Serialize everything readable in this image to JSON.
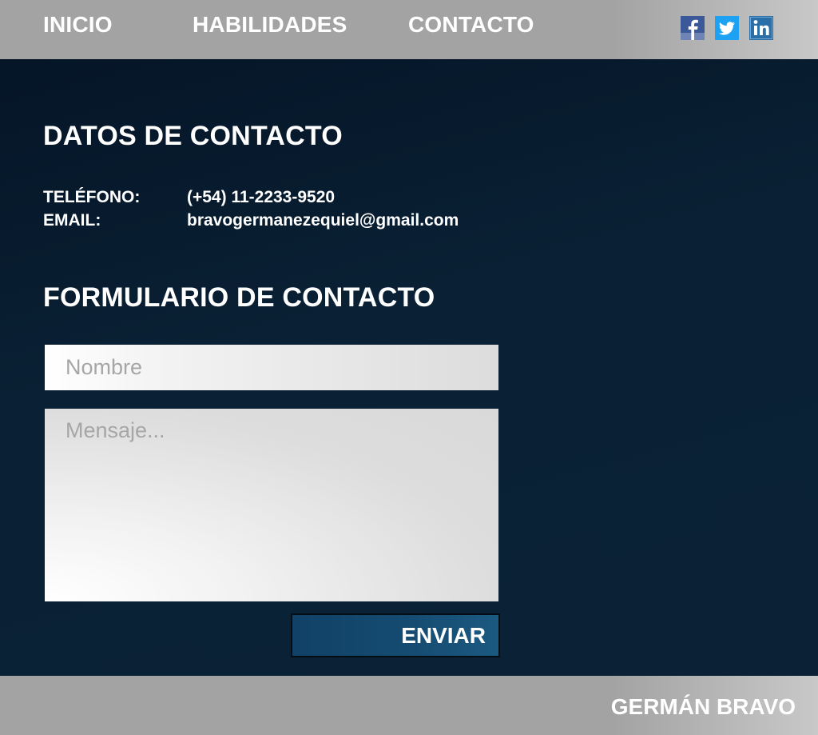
{
  "nav": {
    "items": [
      {
        "label": "INICIO"
      },
      {
        "label": "HABILIDADES"
      },
      {
        "label": "CONTACTO"
      }
    ],
    "social": [
      {
        "icon": "facebook-icon",
        "color": "#3b5998"
      },
      {
        "icon": "twitter-icon",
        "color": "#1da1f2"
      },
      {
        "icon": "linkedin-icon",
        "color": "#2a6fa8"
      }
    ]
  },
  "contact_info": {
    "title": "DATOS DE CONTACTO",
    "phone_label": "TELÉFONO:",
    "phone_value": "(+54) 11-2233-9520",
    "email_label": "EMAIL:",
    "email_value": "bravogermanezequiel@gmail.com"
  },
  "form": {
    "title": "FORMULARIO DE CONTACTO",
    "name_placeholder": "Nombre",
    "name_value": "",
    "message_placeholder": "Mensaje...",
    "message_value": "",
    "submit_label": "ENVIAR"
  },
  "footer": {
    "name": "GERMÁN BRAVO"
  },
  "colors": {
    "bars": "#a3a3a3",
    "background": "#0b2033",
    "button": "#164c72",
    "text": "#ffffff"
  }
}
